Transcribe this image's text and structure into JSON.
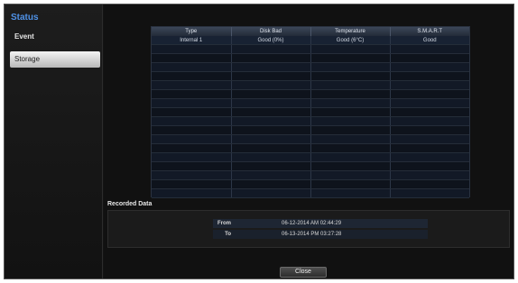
{
  "sidebar": {
    "title": "Status",
    "items": [
      {
        "label": "Event"
      },
      {
        "label": "Storage"
      }
    ]
  },
  "storage_table": {
    "headers": [
      "Type",
      "Disk Bad",
      "Temperature",
      "S.M.A.R.T"
    ],
    "rows": [
      [
        "Internal 1",
        "Good (0%)",
        "Good (6°C)",
        "Good"
      ]
    ]
  },
  "recorded_data": {
    "title": "Recorded Data",
    "from_label": "From",
    "from_value": "06-12-2014  AM 02:44:29",
    "to_label": "To",
    "to_value": "06-13-2014  PM 03:27:28"
  },
  "close_label": "Close"
}
